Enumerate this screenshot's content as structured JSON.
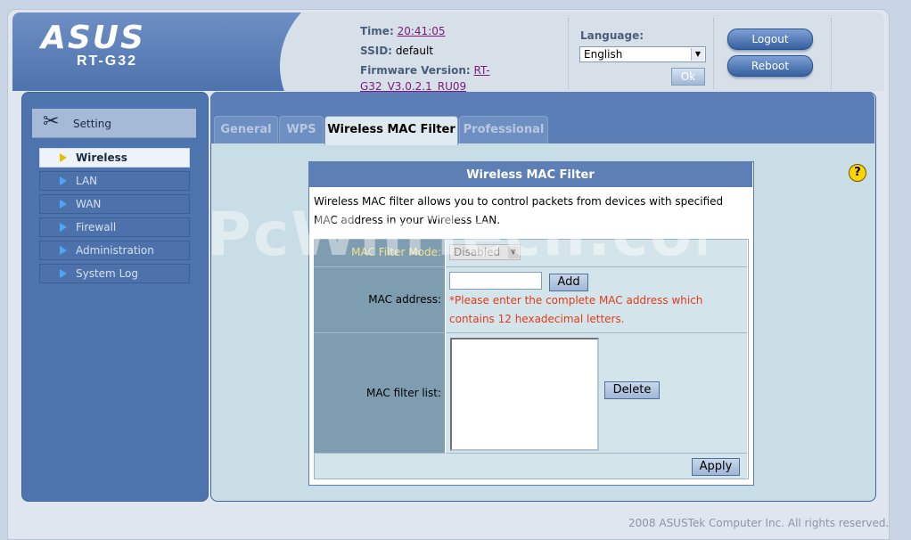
{
  "header": {
    "brand": "ASUS",
    "model": "RT-G32",
    "time_label": "Time:",
    "time_value": "20:41:05",
    "ssid_label": "SSID:",
    "ssid_value": "default",
    "firmware_label": "Firmware Version:",
    "firmware_value_1": "RT-",
    "firmware_value_2": "G32_V3.0.2.1_RU09",
    "language_label": "Language:",
    "language_value": "English",
    "ok_label": "Ok",
    "logout_label": "Logout",
    "reboot_label": "Reboot"
  },
  "sidebar": {
    "section_label": "Setting",
    "items": [
      {
        "label": "Wireless"
      },
      {
        "label": "LAN"
      },
      {
        "label": "WAN"
      },
      {
        "label": "Firewall"
      },
      {
        "label": "Administration"
      },
      {
        "label": "System Log"
      }
    ]
  },
  "tabs": [
    {
      "label": "General"
    },
    {
      "label": "WPS"
    },
    {
      "label": "Wireless MAC Filter"
    },
    {
      "label": "Professional"
    }
  ],
  "mac_filter": {
    "title": "Wireless MAC Filter",
    "description": "Wireless MAC filter allows you to control packets from devices with specified MAC address in your Wireless LAN.",
    "mode_label": "MAC Filter Mode:",
    "mode_value": "Disabled",
    "mac_label": "MAC address:",
    "add_label": "Add",
    "warning": "*Please enter the complete MAC address which contains 12 hexadecimal letters.",
    "list_label": "MAC filter list:",
    "delete_label": "Delete",
    "apply_label": "Apply"
  },
  "help_symbol": "?",
  "watermark": "PcWinTech.com",
  "footer": "2008 ASUSTek Computer Inc. All rights reserved.",
  "colors": {
    "header_bg": "#d7dfe9",
    "sidebar_bg": "#4e74ad",
    "panel_bg": "#c9dde6",
    "title_bar": "#5d7fb5",
    "warning_text": "#e33b1a"
  }
}
